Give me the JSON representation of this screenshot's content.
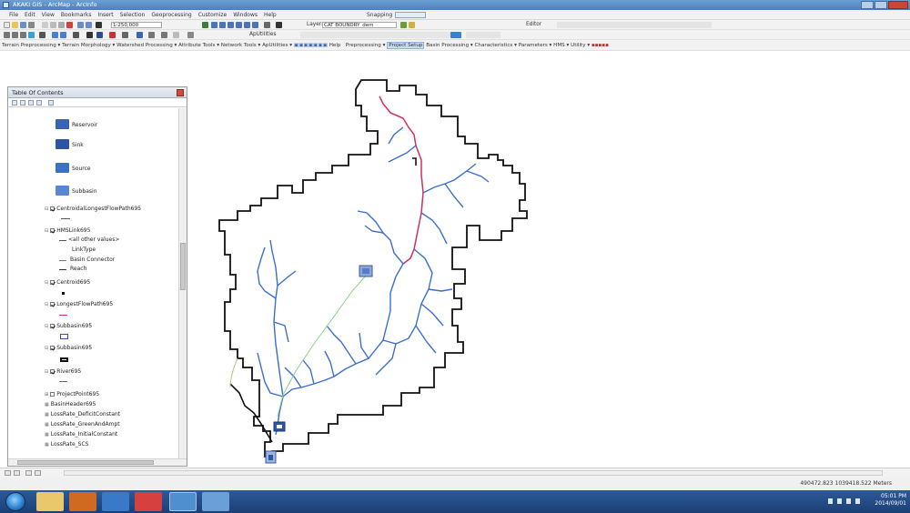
{
  "window": {
    "title": "AKAKI GIS - ArcMap - ArcInfo"
  },
  "menubar": {
    "items": [
      "File",
      "Edit",
      "View",
      "Bookmarks",
      "Insert",
      "Selection",
      "Geoprocessing",
      "Customize",
      "Windows",
      "Help"
    ],
    "snapping_label": "Snapping"
  },
  "toolbar1": {
    "scale": "1:250,000",
    "layer_label": "Layer:",
    "layer_value": "CAT BOUNDRY_dem",
    "editor_label": "Editor"
  },
  "toolbar2": {
    "aputilities_label": "ApUtilities"
  },
  "toolbar3": {
    "items": [
      "Terrain Preprocessing",
      "Terrain Morphology",
      "Watershed Processing",
      "Attribute Tools",
      "Network Tools",
      "ApUtilities",
      "Help"
    ],
    "hms_items": [
      "Preprocessing",
      "Project Setup",
      "Basin Processing",
      "Characteristics",
      "Parameters",
      "HMS",
      "Utility"
    ]
  },
  "toc": {
    "title": "Table Of Contents",
    "legend_items": {
      "reservoir": "Reservoir",
      "sink": "Sink",
      "source": "Source",
      "subbasin": "Subbasin"
    },
    "layers": {
      "centroidal": "CentroidalLongestFlowPath695",
      "hmslink": "HMSLink695",
      "all_other": "<all other values>",
      "linktype": "LinkType",
      "basin_connector": "Basin Connector",
      "reach": "Reach",
      "centroid": "Centroid695",
      "longest": "LongestFlowPath695",
      "subbasin1": "Subbasin695",
      "subbasin2": "Subbasin695",
      "river": "River695",
      "projectpoint": "ProjectPoint695",
      "basinheader": "BasinHeader695",
      "loss_deficit": "LossRate_DeficitConstant",
      "loss_green": "LossRate_GreenAndAmpt",
      "loss_initial": "LossRate_InitialConstant",
      "loss_scs": "LossRate_SCS"
    }
  },
  "status": {
    "coords": "490472.823  1039418.522 Meters"
  },
  "taskbar": {
    "time": "05:01 PM",
    "date": "2014/09/01"
  },
  "colors": {
    "boundary": "#111111",
    "longest_flow_path": "#d03060",
    "river": "#3a6fd0",
    "centroidal_path": "#8cd08c",
    "old_river": "#c8b98c"
  }
}
